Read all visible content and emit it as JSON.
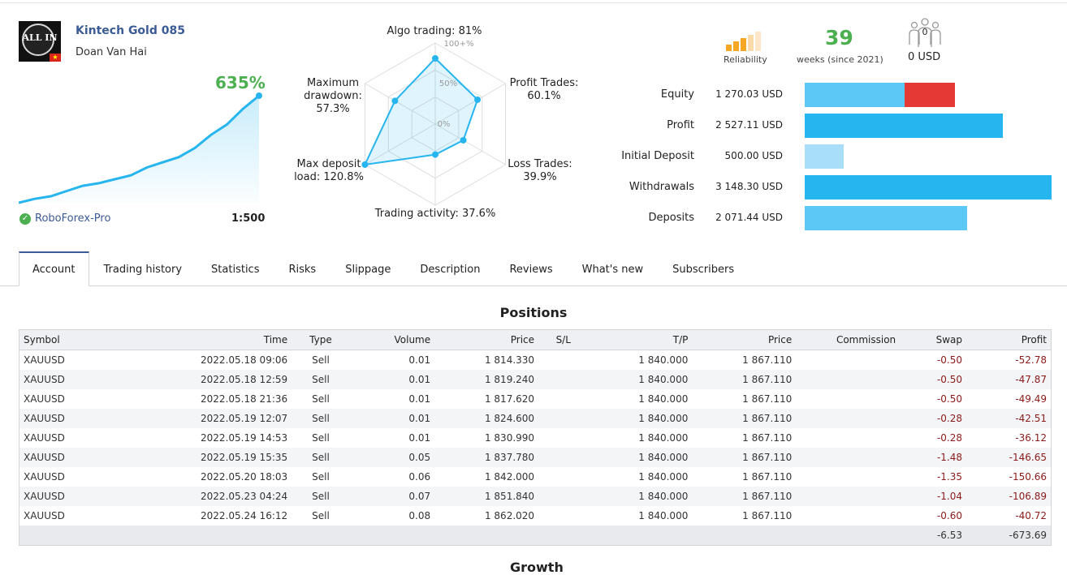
{
  "signal": {
    "name": "Kintech Gold 085",
    "author": "Doan Van Hai",
    "logo_text": "ALL IN",
    "flag_star": "★"
  },
  "growth": "635%",
  "growth_curve": [
    0,
    3,
    5,
    9,
    13,
    15,
    18,
    21,
    27,
    31,
    35,
    42,
    52,
    60,
    72,
    82
  ],
  "broker": "RoboForex-Pro",
  "broker_icon": "check-shield-icon",
  "leverage": "1:500",
  "radar": {
    "scale_labels": [
      "100+%",
      "50%",
      "0%"
    ],
    "axes": [
      {
        "label": "Algo trading: 81%",
        "value": 81
      },
      {
        "label_line1": "Profit Trades:",
        "label_line2": "60.1%",
        "value": 60.1
      },
      {
        "label_line1": "Loss Trades:",
        "label_line2": "39.9%",
        "value": 39.9
      },
      {
        "label": "Trading activity: 37.6%",
        "value": 37.6
      },
      {
        "label_line1": "Max deposit",
        "label_line2": "load: 120.8%",
        "value": 120.8
      },
      {
        "label_line1": "Maximum",
        "label_line2": "drawdown:",
        "label_line3": "57.3%",
        "value": 57.3
      }
    ]
  },
  "reliability_label": "Reliability",
  "weeks": {
    "value": "39",
    "label": "weeks (since 2021)"
  },
  "subscribers": {
    "count": "0",
    "amount": "0 USD"
  },
  "balances": [
    {
      "label": "Equity",
      "value": "1 270.03 USD",
      "amount": 1270.03,
      "color": "#5bc8f5",
      "loss": 650,
      "loss_color": "#e53935"
    },
    {
      "label": "Profit",
      "value": "2 527.11 USD",
      "amount": 2527.11,
      "color": "#26b5ef"
    },
    {
      "label": "Initial Deposit",
      "value": "500.00 USD",
      "amount": 500.0,
      "color": "#a8def7"
    },
    {
      "label": "Withdrawals",
      "value": "3 148.30 USD",
      "amount": 3148.3,
      "color": "#26b5ef"
    },
    {
      "label": "Deposits",
      "value": "2 071.44 USD",
      "amount": 2071.44,
      "color": "#5bc8f5"
    }
  ],
  "tabs": [
    "Account",
    "Trading history",
    "Statistics",
    "Risks",
    "Slippage",
    "Description",
    "Reviews",
    "What's new",
    "Subscribers"
  ],
  "positions": {
    "title": "Positions",
    "columns": [
      "Symbol",
      "Time",
      "Type",
      "Volume",
      "Price",
      "S/L",
      "T/P",
      "Price",
      "Commission",
      "Swap",
      "Profit"
    ],
    "rows": [
      [
        "XAUUSD",
        "2022.05.18 09:06",
        "Sell",
        "0.01",
        "1 814.330",
        "",
        "1 840.000",
        "1 867.110",
        "",
        "-0.50",
        "-52.78"
      ],
      [
        "XAUUSD",
        "2022.05.18 12:59",
        "Sell",
        "0.01",
        "1 819.240",
        "",
        "1 840.000",
        "1 867.110",
        "",
        "-0.50",
        "-47.87"
      ],
      [
        "XAUUSD",
        "2022.05.18 21:36",
        "Sell",
        "0.01",
        "1 817.620",
        "",
        "1 840.000",
        "1 867.110",
        "",
        "-0.50",
        "-49.49"
      ],
      [
        "XAUUSD",
        "2022.05.19 12:07",
        "Sell",
        "0.01",
        "1 824.600",
        "",
        "1 840.000",
        "1 867.110",
        "",
        "-0.28",
        "-42.51"
      ],
      [
        "XAUUSD",
        "2022.05.19 14:53",
        "Sell",
        "0.01",
        "1 830.990",
        "",
        "1 840.000",
        "1 867.110",
        "",
        "-0.28",
        "-36.12"
      ],
      [
        "XAUUSD",
        "2022.05.19 15:35",
        "Sell",
        "0.05",
        "1 837.780",
        "",
        "1 840.000",
        "1 867.110",
        "",
        "-1.48",
        "-146.65"
      ],
      [
        "XAUUSD",
        "2022.05.20 18:03",
        "Sell",
        "0.06",
        "1 842.000",
        "",
        "1 840.000",
        "1 867.110",
        "",
        "-1.35",
        "-150.66"
      ],
      [
        "XAUUSD",
        "2022.05.23 04:24",
        "Sell",
        "0.07",
        "1 851.840",
        "",
        "1 840.000",
        "1 867.110",
        "",
        "-1.04",
        "-106.89"
      ],
      [
        "XAUUSD",
        "2022.05.24 16:12",
        "Sell",
        "0.08",
        "1 862.020",
        "",
        "1 840.000",
        "1 867.110",
        "",
        "-0.60",
        "-40.72"
      ]
    ],
    "total_swap": "-6.53",
    "total_profit": "-673.69"
  },
  "next_section_title": "Growth"
}
